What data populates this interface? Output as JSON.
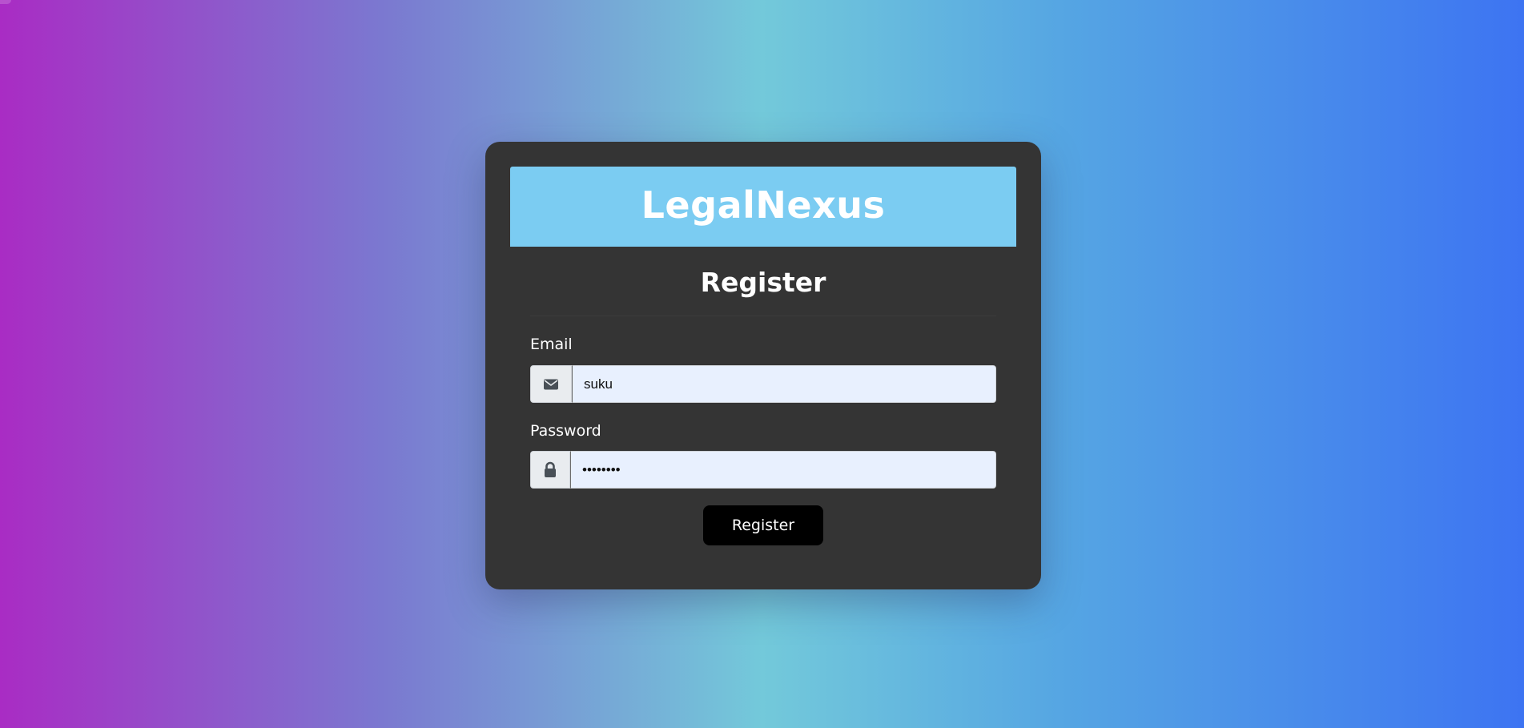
{
  "brand": {
    "title": "LegalNexus"
  },
  "form": {
    "title": "Register",
    "email": {
      "label": "Email",
      "value": "suku",
      "icon": "envelope-icon"
    },
    "password": {
      "label": "Password",
      "value": "password",
      "icon": "lock-icon"
    },
    "submit_label": "Register"
  },
  "colors": {
    "card_background": "#343434",
    "brand_bar": "#7bccf2",
    "input_background": "#e8f0fe",
    "button_background": "#000000"
  }
}
